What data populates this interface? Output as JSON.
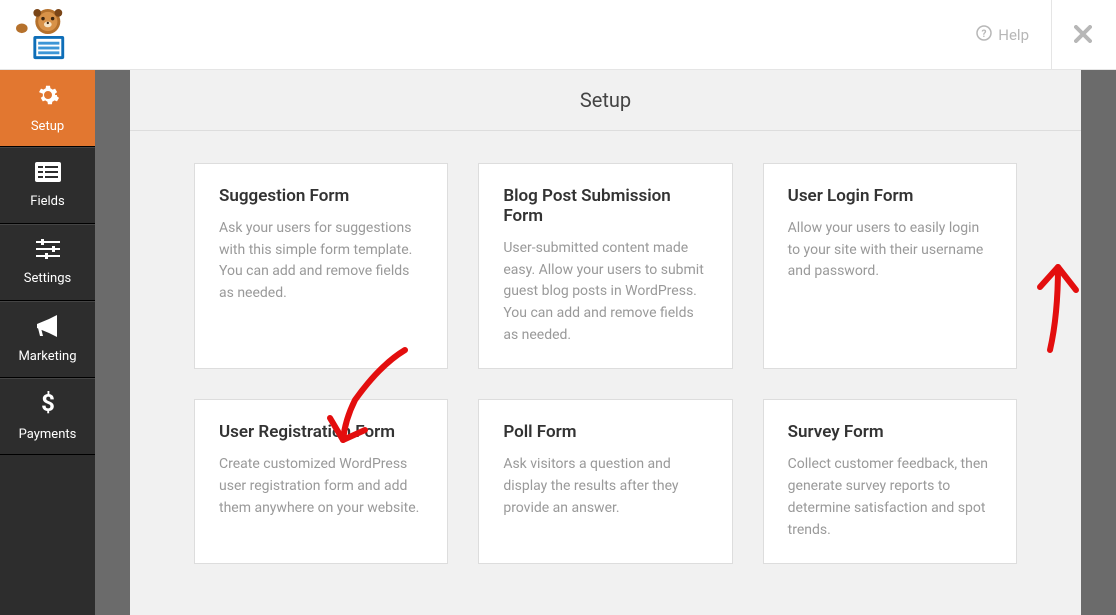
{
  "header": {
    "help_label": "Help"
  },
  "sidebar": {
    "items": [
      {
        "label": "Setup",
        "icon": "gear",
        "active": true
      },
      {
        "label": "Fields",
        "icon": "list",
        "active": false
      },
      {
        "label": "Settings",
        "icon": "sliders",
        "active": false
      },
      {
        "label": "Marketing",
        "icon": "bullhorn",
        "active": false
      },
      {
        "label": "Payments",
        "icon": "dollar",
        "active": false
      }
    ]
  },
  "main": {
    "section_title": "Setup",
    "templates": [
      {
        "title": "Suggestion Form",
        "desc": "Ask your users for suggestions with this simple form template. You can add and remove fields as needed."
      },
      {
        "title": "Blog Post Submission Form",
        "desc": "User-submitted content made easy. Allow your users to submit guest blog posts in WordPress. You can add and remove fields as needed."
      },
      {
        "title": "User Login Form",
        "desc": "Allow your users to easily login to your site with their username and password."
      },
      {
        "title": "User Registration Form",
        "desc": "Create customized WordPress user registration form and add them anywhere on your website."
      },
      {
        "title": "Poll Form",
        "desc": "Ask visitors a question and display the results after they provide an answer."
      },
      {
        "title": "Survey Form",
        "desc": "Collect customer feedback, then generate survey reports to determine satisfaction and spot trends."
      }
    ]
  }
}
